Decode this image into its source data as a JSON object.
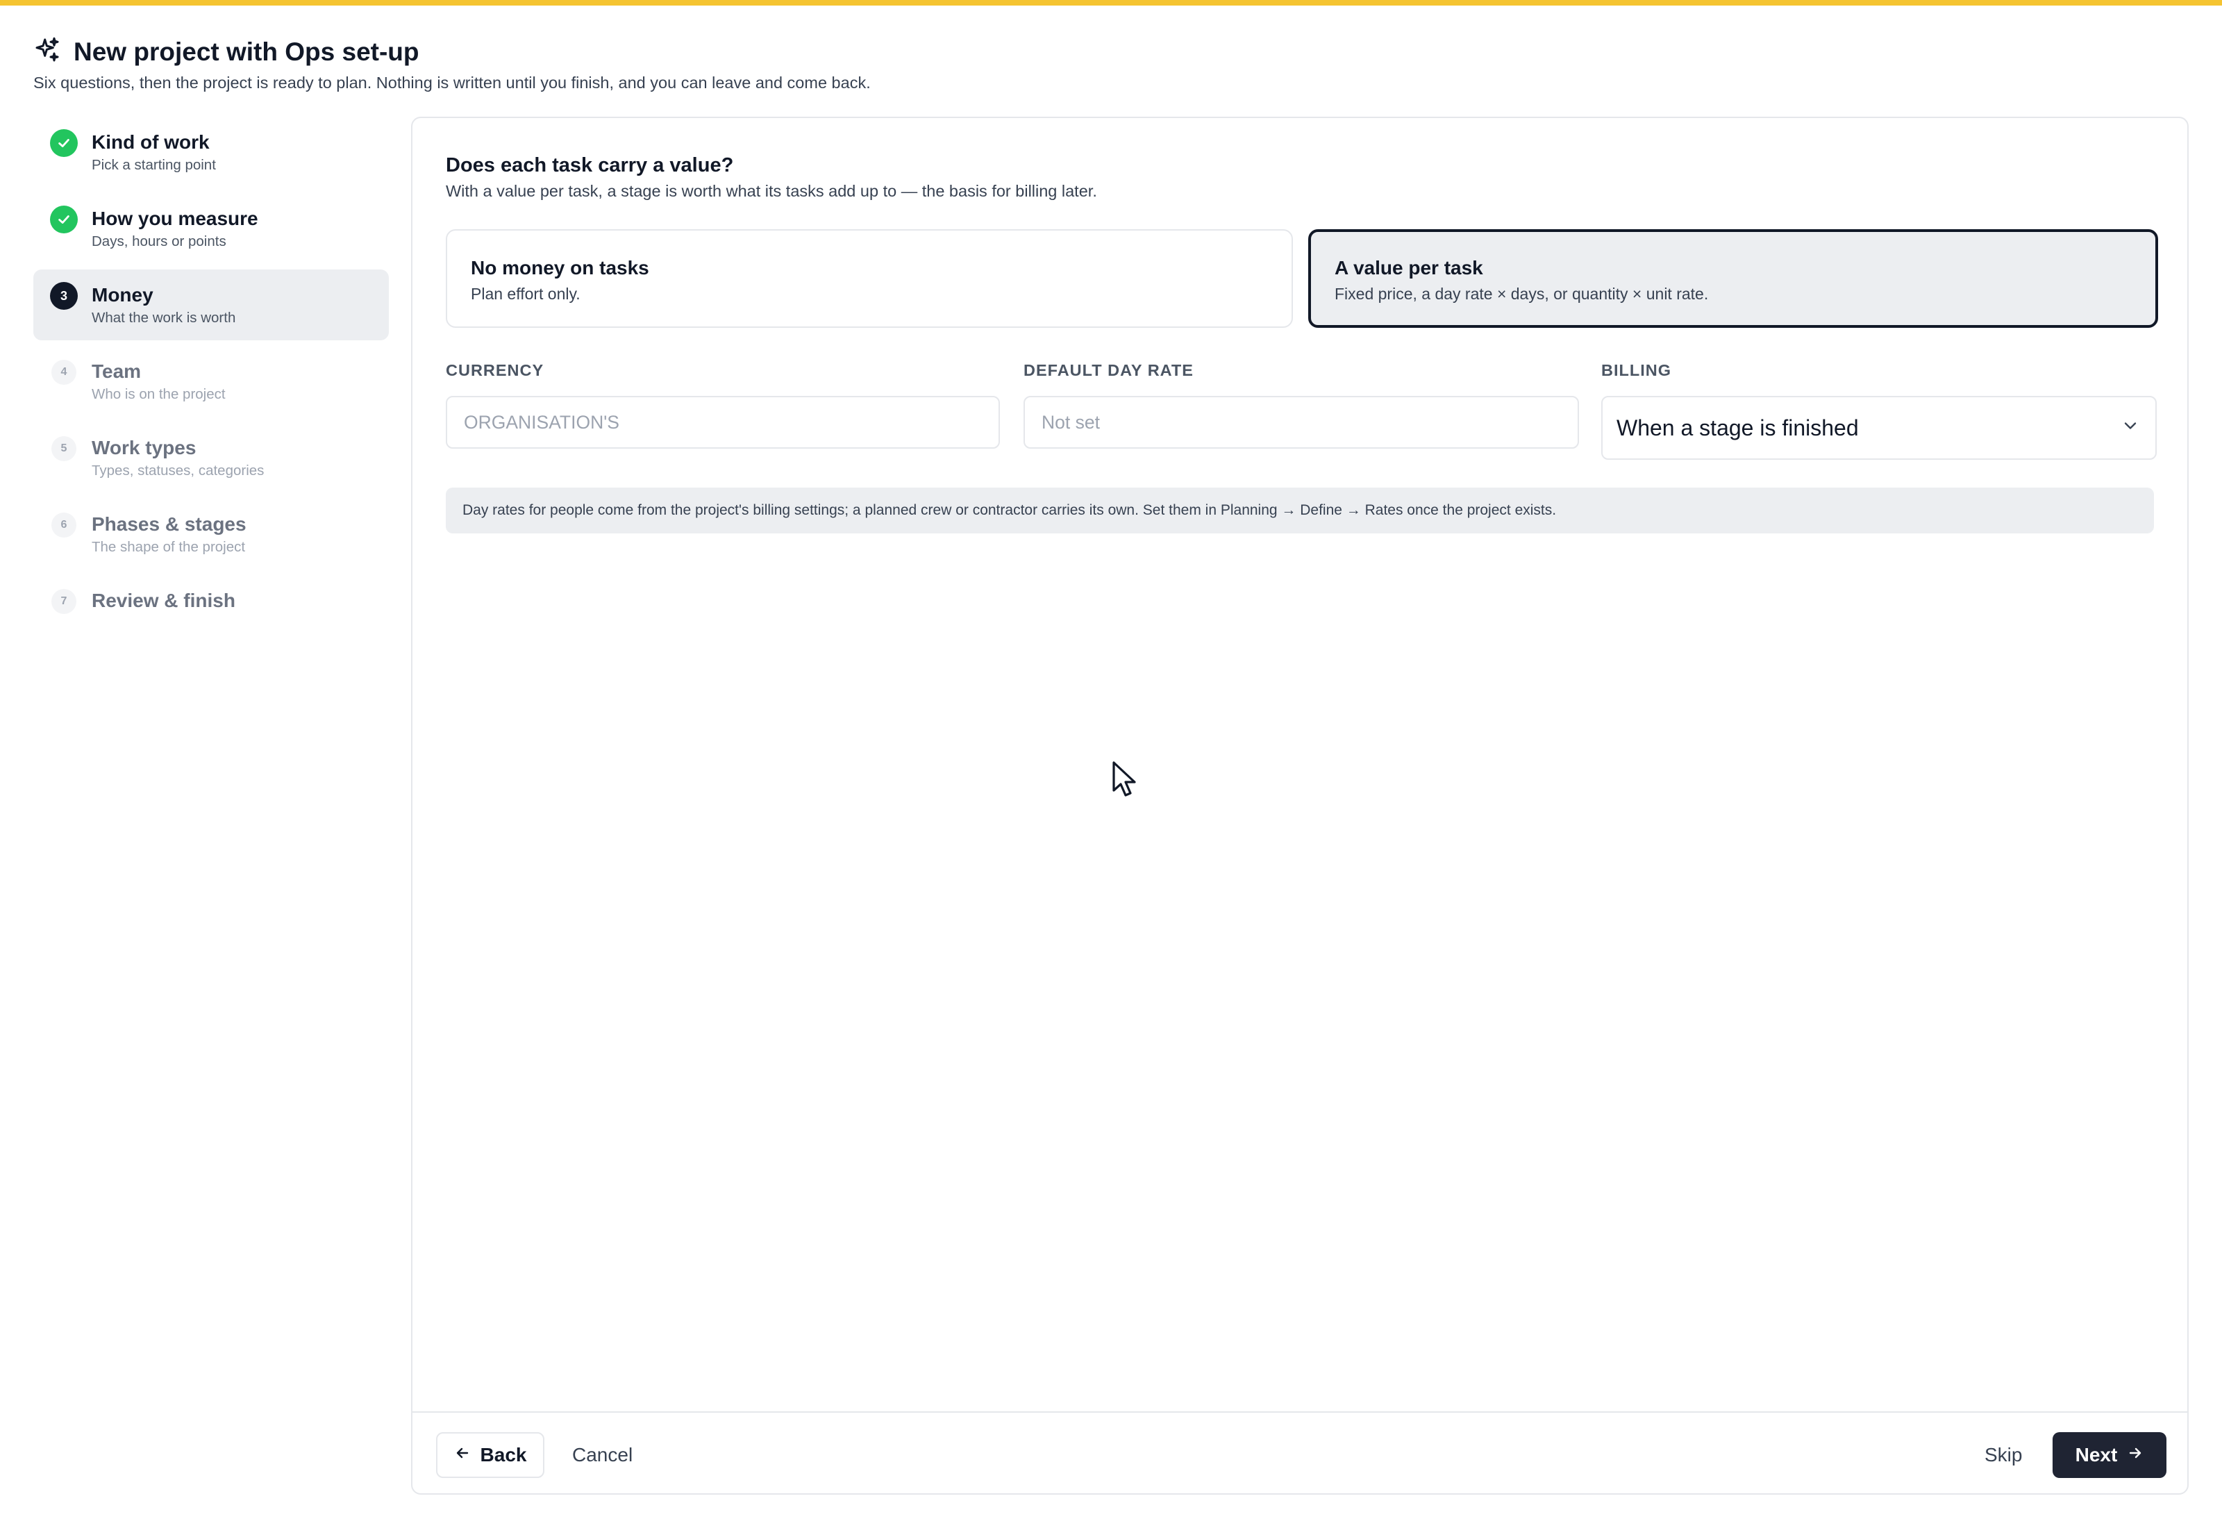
{
  "header": {
    "title": "New project with Ops set-up",
    "subtitle": "Six questions, then the project is ready to plan. Nothing is written until you finish, and you can leave and come back.",
    "icon": "sparkles-icon"
  },
  "sidebar": {
    "steps": [
      {
        "number": "1",
        "label": "Kind of work",
        "hint": "Pick a starting point",
        "state": "done"
      },
      {
        "number": "2",
        "label": "How you measure",
        "hint": "Days, hours or points",
        "state": "done"
      },
      {
        "number": "3",
        "label": "Money",
        "hint": "What the work is worth",
        "state": "active"
      },
      {
        "number": "4",
        "label": "Team",
        "hint": "Who is on the project",
        "state": "pending"
      },
      {
        "number": "5",
        "label": "Work types",
        "hint": "Types, statuses, categories",
        "state": "pending"
      },
      {
        "number": "6",
        "label": "Phases & stages",
        "hint": "The shape of the project",
        "state": "pending"
      },
      {
        "number": "7",
        "label": "Review & finish",
        "hint": "",
        "state": "pending"
      }
    ]
  },
  "main": {
    "question": "Does each task carry a value?",
    "question_hint": "With a value per task, a stage is worth what its tasks add up to — the basis for billing later.",
    "options": [
      {
        "label": "No money on tasks",
        "hint": "Plan effort only.",
        "selected": false
      },
      {
        "label": "A value per task",
        "hint": "Fixed price, a day rate × days, or quantity × unit rate.",
        "selected": true
      }
    ],
    "fields": {
      "currency": {
        "label": "CURRENCY",
        "placeholder": "ORGANISATION'S",
        "value": ""
      },
      "day_rate": {
        "label": "DEFAULT DAY RATE",
        "placeholder": "Not set",
        "value": ""
      },
      "billing": {
        "label": "BILLING",
        "value": "When a stage is finished"
      }
    },
    "info_note": "Day rates for people come from the project's billing settings; a planned crew or contractor carries its own. Set them in Planning → Define → Rates once the project exists."
  },
  "footer": {
    "back": "Back",
    "cancel": "Cancel",
    "skip": "Skip",
    "next": "Next"
  },
  "colors": {
    "accent_bar": "#f5c431",
    "done": "#22c55e",
    "primary": "#1f2433",
    "selected_bg": "#eceef1"
  }
}
